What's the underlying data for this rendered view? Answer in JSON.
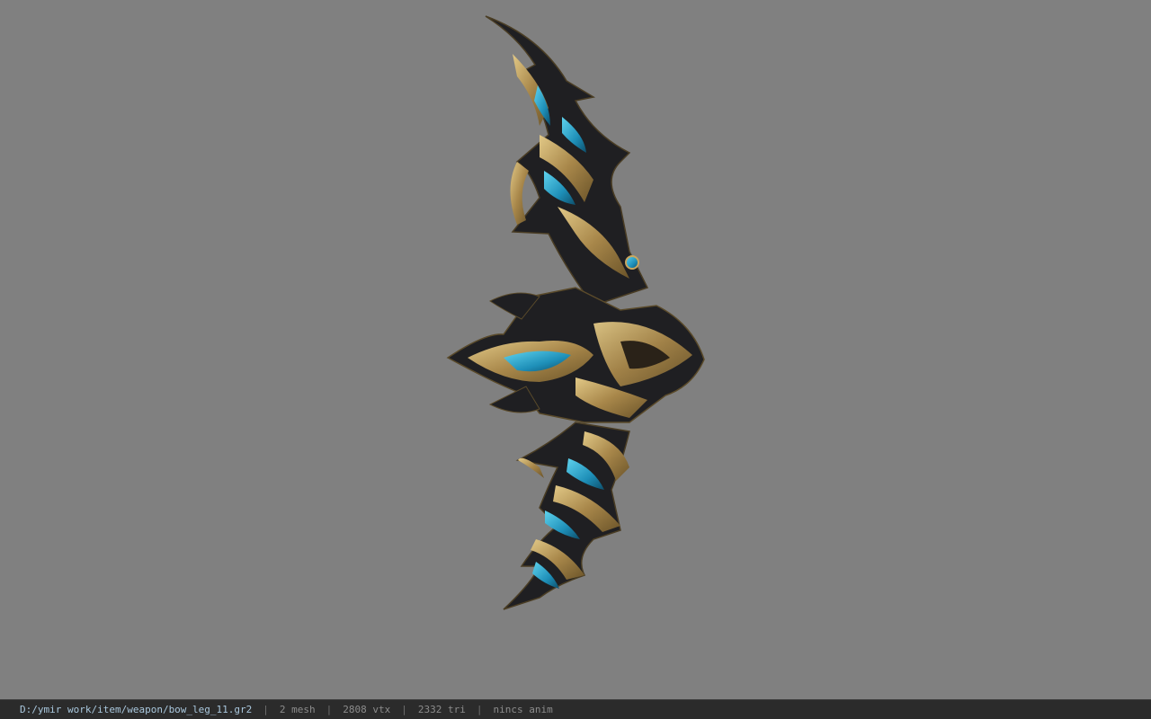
{
  "viewport": {
    "background": "#808080",
    "model_icon": "bow-model"
  },
  "statusbar": {
    "path": "D:/ymir work/item/weapon/bow_leg_11.gr2",
    "separator": "|",
    "mesh": "2 mesh",
    "vtx": "2808 vtx",
    "tri": "2332 tri",
    "anim": "nincs anim"
  },
  "colors": {
    "gold": "#b8964f",
    "dark": "#1e1e20",
    "blue": "#2aa6c8",
    "statusbar_bg": "#2b2b2b",
    "path_text": "#a9c7dd"
  }
}
